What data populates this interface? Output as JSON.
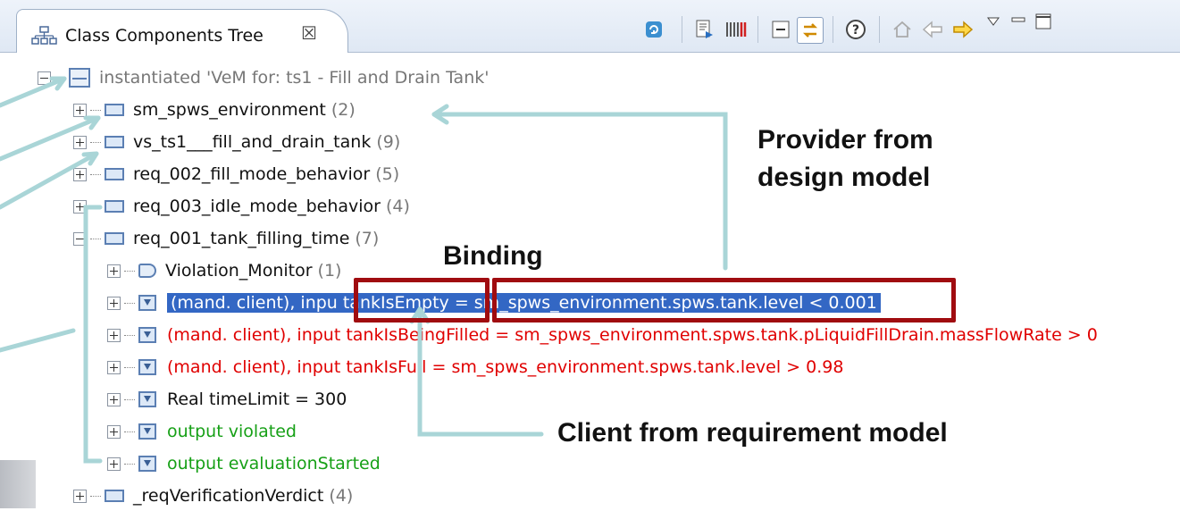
{
  "tab": {
    "icon": "class-tree-icon",
    "title": "Class Components Tree",
    "close_glyph": "☒"
  },
  "toolbar": {
    "icons": [
      "refresh-icon",
      "export-icon",
      "barcode-icon",
      "collapse-icon",
      "link-editor-icon",
      "help-icon",
      "home-icon",
      "back-arrow-icon",
      "forward-arrow-icon",
      "view-menu-icon",
      "minimize-icon",
      "maximize-icon"
    ]
  },
  "tree": {
    "root": "instantiated 'VeM for: ts1 - Fill and Drain Tank'",
    "children": [
      {
        "name": "sm_spws_environment",
        "count": "(2)"
      },
      {
        "name": "vs_ts1___fill_and_drain_tank",
        "count": "(9)"
      },
      {
        "name": "req_002_fill_mode_behavior",
        "count": "(5)"
      },
      {
        "name": "req_003_idle_mode_behavior",
        "count": "(4)"
      },
      {
        "name": "req_001_tank_filling_time",
        "count": "(7)"
      }
    ],
    "req001_children": {
      "monitor": {
        "name": "Violation_Monitor",
        "count": "(1)"
      },
      "row1_prefix": "(mand. client), inpu",
      "row1_client": "tankIsEmpty",
      "row1_eq": " = ",
      "row1_provider": "sm_spws_environment.spws.tank.level < 0.001",
      "row2": "(mand. client), input tankIsBeingFilled = sm_spws_environment.spws.tank.pLiquidFillDrain.massFlowRate > 0",
      "row3": "(mand. client), input tankIsFull = sm_spws_environment.spws.tank.level > 0.98",
      "row4": "Real timeLimit = 300",
      "row5": "output violated",
      "row6": "output evaluationStarted"
    },
    "last": {
      "name": "_reqVerificationVerdict",
      "count": "(4)"
    }
  },
  "annotations": {
    "provider": "Provider from\ndesign model",
    "binding": "Binding",
    "client": "Client from requirement model"
  },
  "colors": {
    "selection": "#3367c4",
    "mandatory": "#e00000",
    "output": "#16a016",
    "box": "#a00c10",
    "arrow": "#a9d5d7"
  }
}
